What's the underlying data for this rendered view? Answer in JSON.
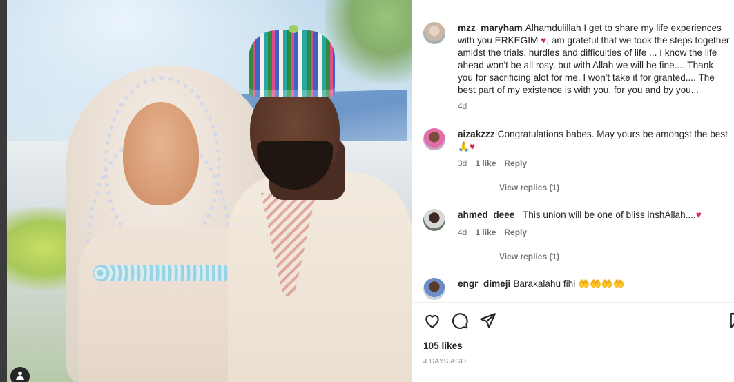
{
  "post": {
    "likes": "105 likes",
    "time": "4 DAYS AGO"
  },
  "comments": [
    {
      "username": "mzz_maryham",
      "text_before_heart": "Alhamdulillah I get to share my life experiences with you ERKEGIM",
      "text_after_heart": ", am grateful that we took the steps together amidst the trials, hurdles and difficulties of life ... I know the life ahead won't be all rosy, but with Allah we will be fine.... Thank you for sacrificing alot for me, I won't take it for granted.... The best part of my existence is with you, for you and by you...",
      "age": "4d"
    },
    {
      "username": "aizakzzz",
      "text": "Congratulations babes. May yours be amongst the best 🙏",
      "age": "3d",
      "likes": "1 like",
      "reply": "Reply",
      "view_replies": "View replies (1)"
    },
    {
      "username": "ahmed_deee_",
      "text": "This union will be one of bliss inshAllah....",
      "age": "4d",
      "likes": "1 like",
      "reply": "Reply",
      "view_replies": "View replies (1)"
    },
    {
      "username": "engr_dimeji",
      "text": "Barakalahu fihi 🤲🤲🤲🤲"
    }
  ],
  "icons": {
    "like": "heart-icon",
    "comment": "comment-icon",
    "share": "send-icon",
    "save": "bookmark-icon",
    "tag": "user-tag-icon"
  },
  "colors": {
    "heart": "#e0245e",
    "muted": "#737373",
    "text": "#262626"
  }
}
